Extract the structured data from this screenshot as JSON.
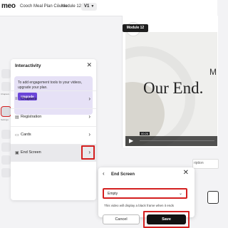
{
  "app": {
    "logo": "meo"
  },
  "breadcrumb": {
    "course": "Cooch Meal Plan Course",
    "module": "Module 12",
    "version": "V1"
  },
  "sidebar": {
    "labels": [
      "",
      "Chapters",
      "",
      "Settings",
      "",
      "",
      "",
      ""
    ]
  },
  "interactivity": {
    "title": "Interactivity",
    "promo_text": "To add engagement tools to your videos, upgrade your plan.",
    "upgrade_label": "Upgrade",
    "items": [
      {
        "label": "Chapters",
        "icon": "list-icon"
      },
      {
        "label": "Registration",
        "icon": "form-icon"
      },
      {
        "label": "Cards",
        "icon": "cards-icon"
      },
      {
        "label": "End Screen",
        "icon": "end-screen-icon"
      }
    ]
  },
  "preview": {
    "module_chip": "Module 12",
    "line1": "MO",
    "line2": "Our End.",
    "time": "00:26"
  },
  "right_side": {
    "field_text": "ription"
  },
  "end_screen": {
    "title": "End Screen",
    "select_value": "Empty",
    "help_text": "This video will display a black frame when it ends",
    "cancel_label": "Cancel",
    "save_label": "Save"
  },
  "colors": {
    "highlight": "#d41f1f",
    "upgrade": "#6a45d8",
    "promo_bg": "#e6e1f6"
  }
}
